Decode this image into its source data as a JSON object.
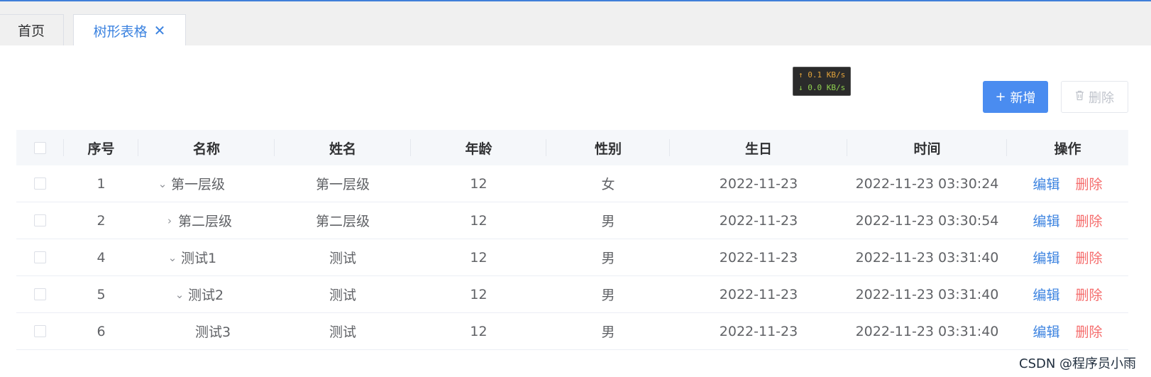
{
  "tabs": [
    {
      "label": "首页"
    },
    {
      "label": "树形表格",
      "close": "✕"
    }
  ],
  "speed": {
    "up": "↑ 0.1 KB/s",
    "down": "↓ 0.0 KB/s"
  },
  "toolbar": {
    "add_icon": "+",
    "add_label": "新增",
    "delete_icon": "trash-icon",
    "delete_label": "删除"
  },
  "table": {
    "columns": [
      "序号",
      "名称",
      "姓名",
      "年龄",
      "性别",
      "生日",
      "时间",
      "操作"
    ],
    "rows": [
      {
        "id": "1",
        "name": "第一层级",
        "person": "第一层级",
        "age": "12",
        "gender": "女",
        "birthday": "2022-11-23",
        "time": "2022-11-23 03:30:24",
        "expand": "⌄",
        "edit": "编辑",
        "delete": "删除"
      },
      {
        "id": "2",
        "name": "第二层级",
        "person": "第二层级",
        "age": "12",
        "gender": "男",
        "birthday": "2022-11-23",
        "time": "2022-11-23 03:30:54",
        "expand": "›",
        "edit": "编辑",
        "delete": "删除"
      },
      {
        "id": "4",
        "name": "测试1",
        "person": "测试",
        "age": "12",
        "gender": "男",
        "birthday": "2022-11-23",
        "time": "2022-11-23 03:31:40",
        "expand": "⌄",
        "edit": "编辑",
        "delete": "删除"
      },
      {
        "id": "5",
        "name": "测试2",
        "person": "测试",
        "age": "12",
        "gender": "男",
        "birthday": "2022-11-23",
        "time": "2022-11-23 03:31:40",
        "expand": "⌄",
        "edit": "编辑",
        "delete": "删除"
      },
      {
        "id": "6",
        "name": "测试3",
        "person": "测试",
        "age": "12",
        "gender": "男",
        "birthday": "2022-11-23",
        "time": "2022-11-23 03:31:40",
        "expand": "",
        "edit": "编辑",
        "delete": "删除"
      }
    ]
  },
  "watermark": "CSDN @程序员小雨"
}
